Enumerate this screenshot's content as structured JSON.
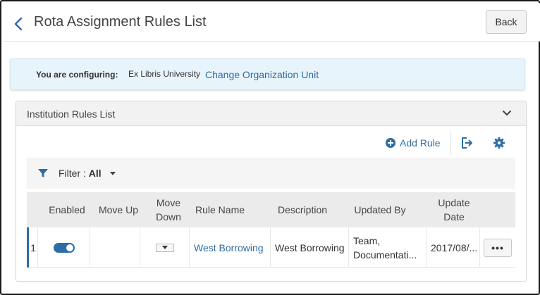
{
  "header": {
    "title": "Rota Assignment Rules List",
    "back_label": "Back"
  },
  "config": {
    "label": "You are configuring:",
    "org": "Ex Libris University",
    "change_link": "Change Organization Unit"
  },
  "panel": {
    "title": "Institution Rules List",
    "add_rule": "Add Rule"
  },
  "filter": {
    "label": "Filter : ",
    "value": "All"
  },
  "table": {
    "columns": {
      "enabled": "Enabled",
      "move_up": "Move Up",
      "move_down_1": "Move",
      "move_down_2": "Down",
      "rule_name": "Rule Name",
      "description": "Description",
      "updated_by": "Updated By",
      "update_date_1": "Update",
      "update_date_2": "Date"
    },
    "rows": [
      {
        "num": "1",
        "enabled": true,
        "rule_name": "West Borrowing",
        "description": "West Borrowing",
        "updated_by_1": "Team,",
        "updated_by_2": "Documentati...",
        "update_date": "2017/08/...",
        "actions_label": "•••"
      }
    ]
  },
  "colors": {
    "accent": "#2e6da4",
    "banner_bg": "#e8f4fb"
  },
  "icons": {
    "back": "chevron-left-icon",
    "collapse": "chevron-down-icon",
    "add": "plus-circle-icon",
    "export": "export-icon",
    "settings": "gear-icon",
    "filter": "filter-icon"
  }
}
